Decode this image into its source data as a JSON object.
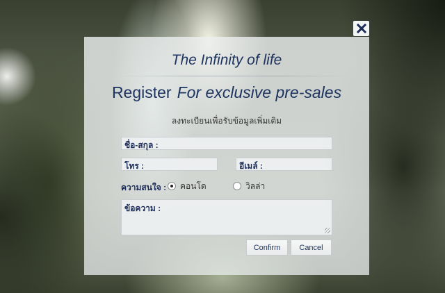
{
  "dialog": {
    "tagline": "The Infinity of life",
    "headline": "Register",
    "headline_sub": "For exclusive pre-sales",
    "note": "ลงทะเบียนเพื่อรับข้อมูลเพิ่มเติม"
  },
  "form": {
    "name_label": "ชื่อ-สกุล :",
    "phone_label": "โทร :",
    "email_label": "อีเมล์ :",
    "interest_label": "ความสนใจ :",
    "options": [
      {
        "label": "คอนโด",
        "selected": true
      },
      {
        "label": "วิลล่า",
        "selected": false
      }
    ],
    "message_label": "ข้อความ :"
  },
  "buttons": {
    "confirm": "Confirm",
    "cancel": "Cancel"
  },
  "icons": {
    "close": "close-icon"
  },
  "colors": {
    "accent": "#1e3460",
    "close_x": "#1c2c58"
  }
}
